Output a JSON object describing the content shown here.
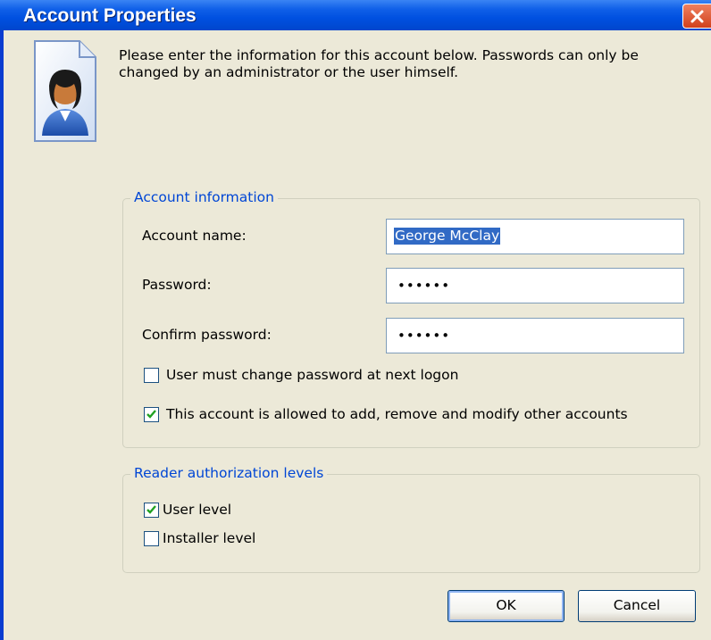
{
  "window": {
    "title": "Account Properties"
  },
  "intro_text": "Please enter the information for this account below. Passwords can only be changed by an administrator or the user himself.",
  "account_group": {
    "title": "Account information",
    "account_name_label": "Account name:",
    "account_name_value": "George McClay",
    "password_label": "Password:",
    "password_value": "••••••",
    "confirm_label": "Confirm password:",
    "confirm_value": "••••••",
    "must_change_label": "User must change password at next logon",
    "must_change_checked": false,
    "allowed_modify_label": "This account is allowed to add, remove and modify other accounts",
    "allowed_modify_checked": true
  },
  "reader_group": {
    "title": "Reader authorization levels",
    "user_level_label": "User level",
    "user_level_checked": true,
    "installer_level_label": "Installer level",
    "installer_level_checked": false
  },
  "buttons": {
    "ok": "OK",
    "cancel": "Cancel"
  },
  "colors": {
    "title_bar": "#0050E0",
    "dialog_bg": "#ECE9D8",
    "group_title": "#0046D5",
    "selection": "#316AC5",
    "checkmark": "#21A121",
    "close_button": "#D0401C"
  },
  "icons": {
    "user": "user-account-icon",
    "close": "close-icon",
    "check": "checkmark-icon"
  }
}
